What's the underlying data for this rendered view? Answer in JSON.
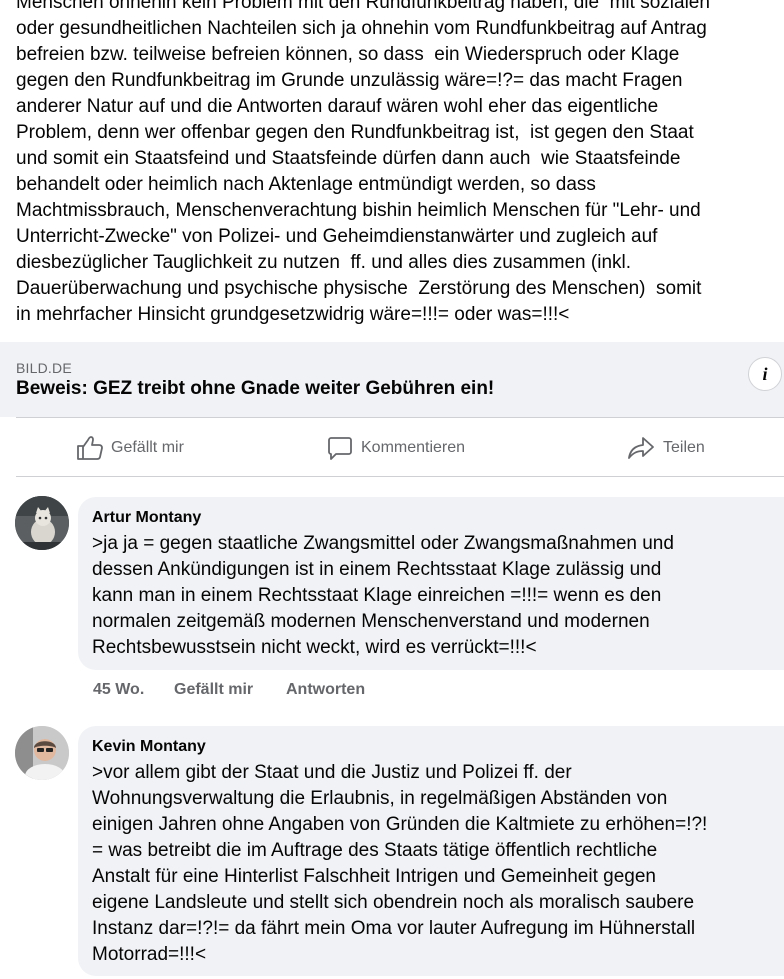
{
  "post": {
    "text": "Menschen ohnehin kein Problem mit den Rundfunkbeitrag haben, die  mit sozialen\noder gesundheitlichen Nachteilen sich ja ohnehin vom Rundfunkbeitrag auf Antrag\nbefreien bzw. teilweise befreien können, so dass  ein Wiederspruch oder Klage\ngegen den Rundfunkbeitrag im Grunde unzulässig wäre=!?= das macht Fragen\nanderer Natur auf und die Antworten darauf wären wohl eher das eigentliche\nProblem, denn wer offenbar gegen den Rundfunkbeitrag ist,  ist gegen den Staat\nund somit ein Staatsfeind und Staatsfeinde dürfen dann auch  wie Staatsfeinde\nbehandelt oder heimlich nach Aktenlage entmündigt werden, so dass\nMachtmissbrauch, Menschenverachtung bishin heimlich Menschen für \"Lehr- und\nUnterricht-Zwecke\" von Polizei- und Geheimdienstanwärter und zugleich auf\ndiesbezüglicher Tauglichkeit zu nutzen  ff. und alles dies zusammen (inkl.\nDauerüberwachung und psychische physische  Zerstörung des Menschen)  somit\nin mehrfacher Hinsicht grundgesetzwidrig wäre=!!!= oder was=!!!<"
  },
  "link": {
    "source": "BILD.DE",
    "title": "Beweis: GEZ treibt ohne Gnade weiter Gebühren ein!",
    "info_icon_glyph": "i"
  },
  "actions": {
    "like": "Gefällt mir",
    "comment": "Kommentieren",
    "share": "Teilen"
  },
  "comments": [
    {
      "author": "Artur Montany",
      "text": ">ja ja = gegen staatliche Zwangsmittel oder Zwangsmaßnahmen und\ndessen Ankündigungen ist in einem Rechtsstaat Klage zulässig und\nkann man in einem Rechtsstaat Klage einreichen =!!!= wenn es den\nnormalen zeitgemäß modernen Menschenverstand und modernen\nRechtsbewusstsein nicht weckt, wird es verrückt=!!!<",
      "time": "45 Wo.",
      "like": "Gefällt mir",
      "reply": "Antworten"
    },
    {
      "author": "Kevin Montany",
      "text": ">vor allem gibt der Staat und die Justiz und Polizei ff. der\nWohnungsverwaltung die Erlaubnis, in regelmäßigen Abständen von\neinigen Jahren ohne Angaben von Gründen die Kaltmiete zu erhöhen=!?!\n= was betreibt die im Auftrage des Staats tätige öffentlich rechtliche\nAnstalt für eine Hinterlist Falschheit Intrigen und Gemeinheit gegen\neigene Landsleute und stellt sich obendrein noch als moralisch saubere\nInstanz dar=!?!= da fährt mein Oma vor lauter Aufregung im Hühnerstall\nMotorrad=!!!<"
    }
  ],
  "colors": {
    "text": "#050505",
    "secondary": "#65676b",
    "bubble": "#f0f2f5",
    "divider": "#ced0d4"
  }
}
